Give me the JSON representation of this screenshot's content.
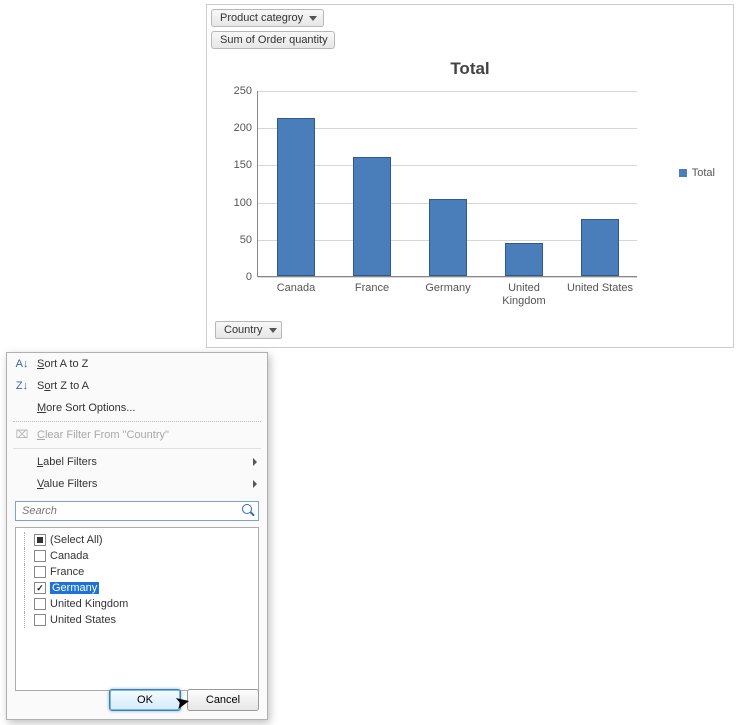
{
  "chart_data": {
    "type": "bar",
    "title": "Total",
    "categories": [
      "Canada",
      "France",
      "Germany",
      "United Kingdom",
      "United States"
    ],
    "values": [
      212,
      160,
      103,
      45,
      77
    ],
    "ylim": [
      0,
      250
    ],
    "ytick_step": 50,
    "series_name": "Total",
    "xlabel": "",
    "ylabel": ""
  },
  "pills": {
    "page_filter": "Product categroy",
    "value_field": "Sum of Order quantity",
    "axis_field": "Country"
  },
  "legend": {
    "label": "Total"
  },
  "filter_menu": {
    "sort_az": "Sort A to Z",
    "sort_za": "Sort Z to A",
    "more_sort": "More Sort Options...",
    "clear_filter": "Clear Filter From \"Country\"",
    "label_filters": "Label Filters",
    "value_filters": "Value Filters",
    "search_placeholder": "Search",
    "items": [
      {
        "label": "(Select All)",
        "state": "mixed",
        "selected": false
      },
      {
        "label": "Canada",
        "state": "unchecked",
        "selected": false
      },
      {
        "label": "France",
        "state": "unchecked",
        "selected": false
      },
      {
        "label": "Germany",
        "state": "checked",
        "selected": true
      },
      {
        "label": "United Kingdom",
        "state": "unchecked",
        "selected": false
      },
      {
        "label": "United States",
        "state": "unchecked",
        "selected": false
      }
    ],
    "ok": "OK",
    "cancel": "Cancel"
  }
}
